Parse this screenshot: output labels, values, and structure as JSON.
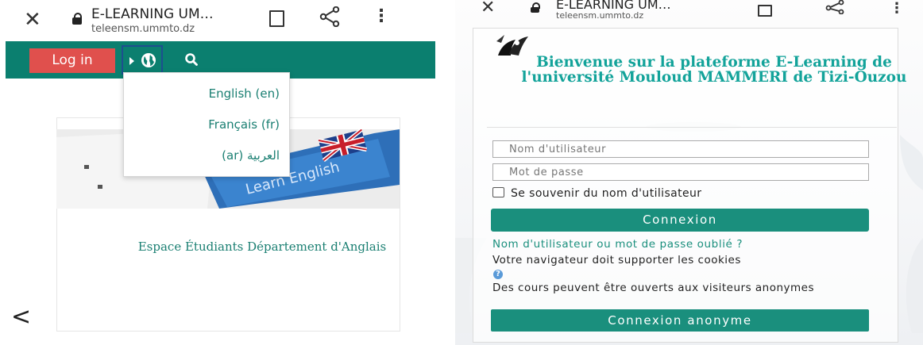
{
  "left": {
    "browser": {
      "title": "E-LEARNING UM…",
      "url": "teleensm.ummto.dz"
    },
    "nav": {
      "login_label": "Log in"
    },
    "language_menu": {
      "items": [
        "English (en)",
        "Français (fr)",
        "العربية (ar)"
      ]
    },
    "course": {
      "image_text": "Learn English",
      "title": "Espace Étudiants Département d'Anglais"
    }
  },
  "right": {
    "browser": {
      "title": "E-LEARNING UM…",
      "url": "teleensm.ummto.dz"
    },
    "welcome": "Bienvenue sur la plateforme E-Learning de l'université Mouloud MAMMERI de Tizi-Ouzou",
    "form": {
      "username_placeholder": "Nom d'utilisateur",
      "password_placeholder": "Mot de passe",
      "remember_label": "Se souvenir du nom d'utilisateur",
      "submit_label": "Connexion"
    },
    "forgot_link": "Nom d'utilisateur ou mot de passe oublié ?",
    "cookies_notice": "Votre navigateur doit supporter les cookies",
    "guest_notice": "Des cours peuvent être ouverts aux visiteurs anonymes",
    "guest_button_label": "Connexion anonyme"
  },
  "colors": {
    "navbar": "#0b7f6f",
    "login_button": "#e0504d",
    "accent_teal": "#1a8f7d",
    "welcome_text": "#13a39a",
    "link": "#1a7f72"
  },
  "icons": [
    "close-icon",
    "lock-icon",
    "bookmark-icon",
    "share-icon",
    "more-vert-icon",
    "globe-icon",
    "search-icon",
    "help-icon",
    "back-arrow-icon",
    "logo"
  ]
}
